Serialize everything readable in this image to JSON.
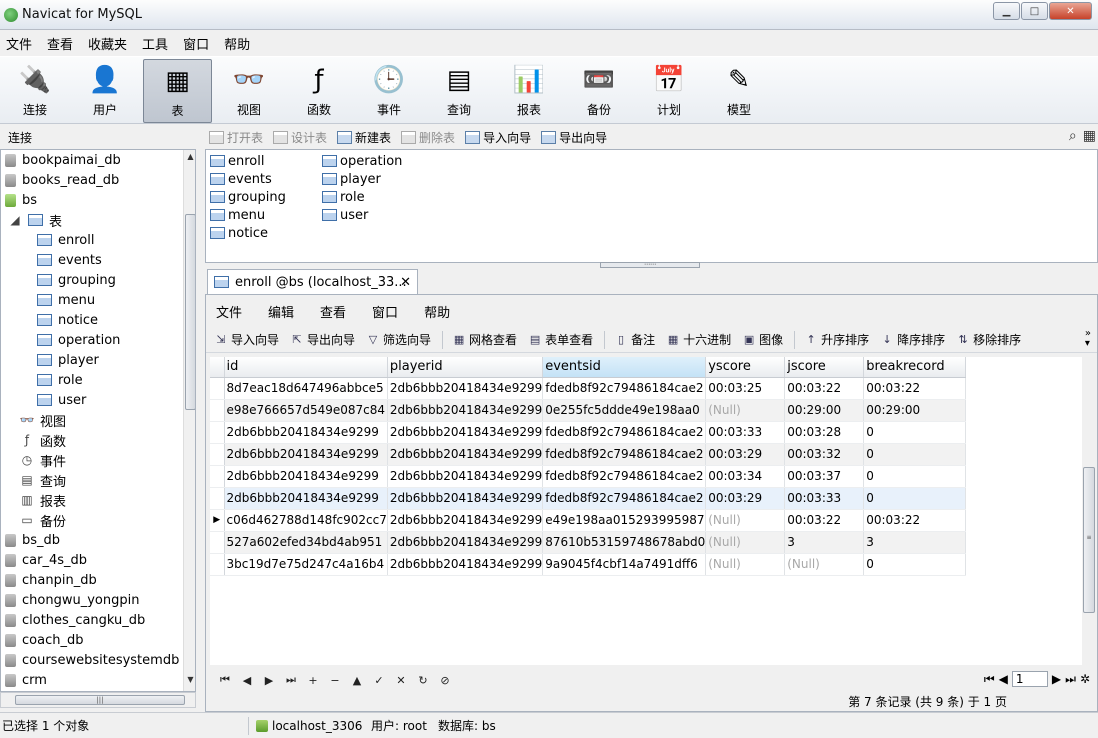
{
  "window": {
    "title": "Navicat for MySQL",
    "buttons": {
      "minimize": "▁",
      "maximize": "□",
      "close": "✕"
    }
  },
  "menubar": [
    "文件",
    "查看",
    "收藏夹",
    "工具",
    "窗口",
    "帮助"
  ],
  "toolbar": [
    {
      "label": "连接",
      "icon": "connect-icon",
      "glyph": "🔌"
    },
    {
      "label": "用户",
      "icon": "user-icon",
      "glyph": "👤"
    },
    {
      "label": "表",
      "icon": "table-icon",
      "glyph": "▦",
      "active": true
    },
    {
      "label": "视图",
      "icon": "view-icon",
      "glyph": "👓"
    },
    {
      "label": "函数",
      "icon": "function-icon",
      "glyph": "ƒ"
    },
    {
      "label": "事件",
      "icon": "event-icon",
      "glyph": "🕒"
    },
    {
      "label": "查询",
      "icon": "query-icon",
      "glyph": "▤"
    },
    {
      "label": "报表",
      "icon": "report-icon",
      "glyph": "📊"
    },
    {
      "label": "备份",
      "icon": "backup-icon",
      "glyph": "📼"
    },
    {
      "label": "计划",
      "icon": "schedule-icon",
      "glyph": "📅"
    },
    {
      "label": "模型",
      "icon": "model-icon",
      "glyph": "✎"
    }
  ],
  "left_panel": {
    "header": "连接",
    "tree": [
      {
        "label": "bookpaimai_db",
        "type": "db",
        "level": 0
      },
      {
        "label": "books_read_db",
        "type": "db",
        "level": 0
      },
      {
        "label": "bs",
        "type": "db-open",
        "level": 0
      },
      {
        "label": "表",
        "type": "folder",
        "level": 1
      },
      {
        "label": "enroll",
        "type": "table",
        "level": 2
      },
      {
        "label": "events",
        "type": "table",
        "level": 2
      },
      {
        "label": "grouping",
        "type": "table",
        "level": 2
      },
      {
        "label": "menu",
        "type": "table",
        "level": 2
      },
      {
        "label": "notice",
        "type": "table",
        "level": 2
      },
      {
        "label": "operation",
        "type": "table",
        "level": 2
      },
      {
        "label": "player",
        "type": "table",
        "level": 2
      },
      {
        "label": "role",
        "type": "table",
        "level": 2
      },
      {
        "label": "user",
        "type": "table",
        "level": 2
      },
      {
        "label": "视图",
        "type": "view",
        "level": 1,
        "glyph": "👓"
      },
      {
        "label": "函数",
        "type": "func",
        "level": 1,
        "glyph": "ƒ"
      },
      {
        "label": "事件",
        "type": "event",
        "level": 1,
        "glyph": "◷"
      },
      {
        "label": "查询",
        "type": "query",
        "level": 1,
        "glyph": "▤"
      },
      {
        "label": "报表",
        "type": "report",
        "level": 1,
        "glyph": "▥"
      },
      {
        "label": "备份",
        "type": "backup",
        "level": 1,
        "glyph": "▭"
      },
      {
        "label": "bs_db",
        "type": "db",
        "level": 0
      },
      {
        "label": "car_4s_db",
        "type": "db",
        "level": 0
      },
      {
        "label": "chanpin_db",
        "type": "db",
        "level": 0
      },
      {
        "label": "chongwu_yongpin",
        "type": "db",
        "level": 0
      },
      {
        "label": "clothes_cangku_db",
        "type": "db",
        "level": 0
      },
      {
        "label": "coach_db",
        "type": "db",
        "level": 0
      },
      {
        "label": "coursewebsitesystemdb",
        "type": "db",
        "level": 0
      },
      {
        "label": "crm",
        "type": "db",
        "level": 0
      }
    ]
  },
  "object_toolbar": [
    {
      "label": "打开表",
      "enabled": false
    },
    {
      "label": "设计表",
      "enabled": false
    },
    {
      "label": "新建表",
      "enabled": true
    },
    {
      "label": "删除表",
      "enabled": false
    },
    {
      "label": "导入向导",
      "enabled": true
    },
    {
      "label": "导出向导",
      "enabled": true
    }
  ],
  "object_list": {
    "col1": [
      "enroll",
      "events",
      "grouping",
      "menu",
      "notice"
    ],
    "col2": [
      "operation",
      "player",
      "role",
      "user"
    ]
  },
  "tab": {
    "label": "enroll @bs (localhost_33...",
    "close": "✕"
  },
  "inner_menu": [
    "文件",
    "编辑",
    "查看",
    "窗口",
    "帮助"
  ],
  "data_toolbar": [
    {
      "label": "导入向导",
      "glyph": "⇲"
    },
    {
      "label": "导出向导",
      "glyph": "⇱"
    },
    {
      "label": "筛选向导",
      "glyph": "▽"
    },
    {
      "label": "网格查看",
      "glyph": "▦"
    },
    {
      "label": "表单查看",
      "glyph": "▤"
    },
    {
      "label": "备注",
      "glyph": "▯"
    },
    {
      "label": "十六进制",
      "glyph": "▦"
    },
    {
      "label": "图像",
      "glyph": "▣"
    },
    {
      "label": "升序排序",
      "glyph": "↑"
    },
    {
      "label": "降序排序",
      "glyph": "↓"
    },
    {
      "label": "移除排序",
      "glyph": "⇅"
    }
  ],
  "grid": {
    "columns": [
      "id",
      "playerid",
      "eventsid",
      "yscore",
      "jscore",
      "breakrecord"
    ],
    "rows": [
      [
        "8d7eac18d647496abbce5",
        "2db6bbb20418434e9299",
        "fdedb8f92c79486184cae2",
        "00:03:25",
        "00:03:22",
        "00:03:22"
      ],
      [
        "e98e766657d549e087c84",
        "2db6bbb20418434e9299",
        "0e255fc5ddde49e198aa0",
        "(Null)",
        "00:29:00",
        "00:29:00"
      ],
      [
        "2db6bbb20418434e9299",
        "2db6bbb20418434e9299",
        "fdedb8f92c79486184cae2",
        "00:03:33",
        "00:03:28",
        "0"
      ],
      [
        "2db6bbb20418434e9299",
        "2db6bbb20418434e9299",
        "fdedb8f92c79486184cae2",
        "00:03:29",
        "00:03:32",
        "0"
      ],
      [
        "2db6bbb20418434e9299",
        "2db6bbb20418434e9299",
        "fdedb8f92c79486184cae2",
        "00:03:34",
        "00:03:37",
        "0"
      ],
      [
        "2db6bbb20418434e9299",
        "2db6bbb20418434e9299",
        "fdedb8f92c79486184cae2",
        "00:03:29",
        "00:03:33",
        "0"
      ],
      [
        "c06d462788d148fc902cc7",
        "2db6bbb20418434e9299",
        "e49e198aa015293995987",
        "(Null)",
        "00:03:22",
        "00:03:22"
      ],
      [
        "527a602efed34bd4ab951",
        "2db6bbb20418434e9299",
        "87610b53159748678abd0",
        "(Null)",
        "3",
        "3"
      ],
      [
        "3bc19d7e75d247c4a16b4",
        "2db6bbb20418434e9299",
        "9a9045f4cbf14a7491dff6",
        "(Null)",
        "(Null)",
        "0"
      ]
    ],
    "current_row": 6
  },
  "nav": {
    "buttons": [
      "⏮",
      "◀",
      "▶",
      "⏭",
      "+",
      "−",
      "▲",
      "✓",
      "✕",
      "↻",
      "⊘"
    ],
    "page": "1",
    "status": "第 7 条记录 (共 9 条) 于 1 页"
  },
  "statusbar": {
    "selection": "已选择 1 个对象",
    "connection": "localhost_3306",
    "user": "用户: root",
    "database": "数据库: bs"
  }
}
